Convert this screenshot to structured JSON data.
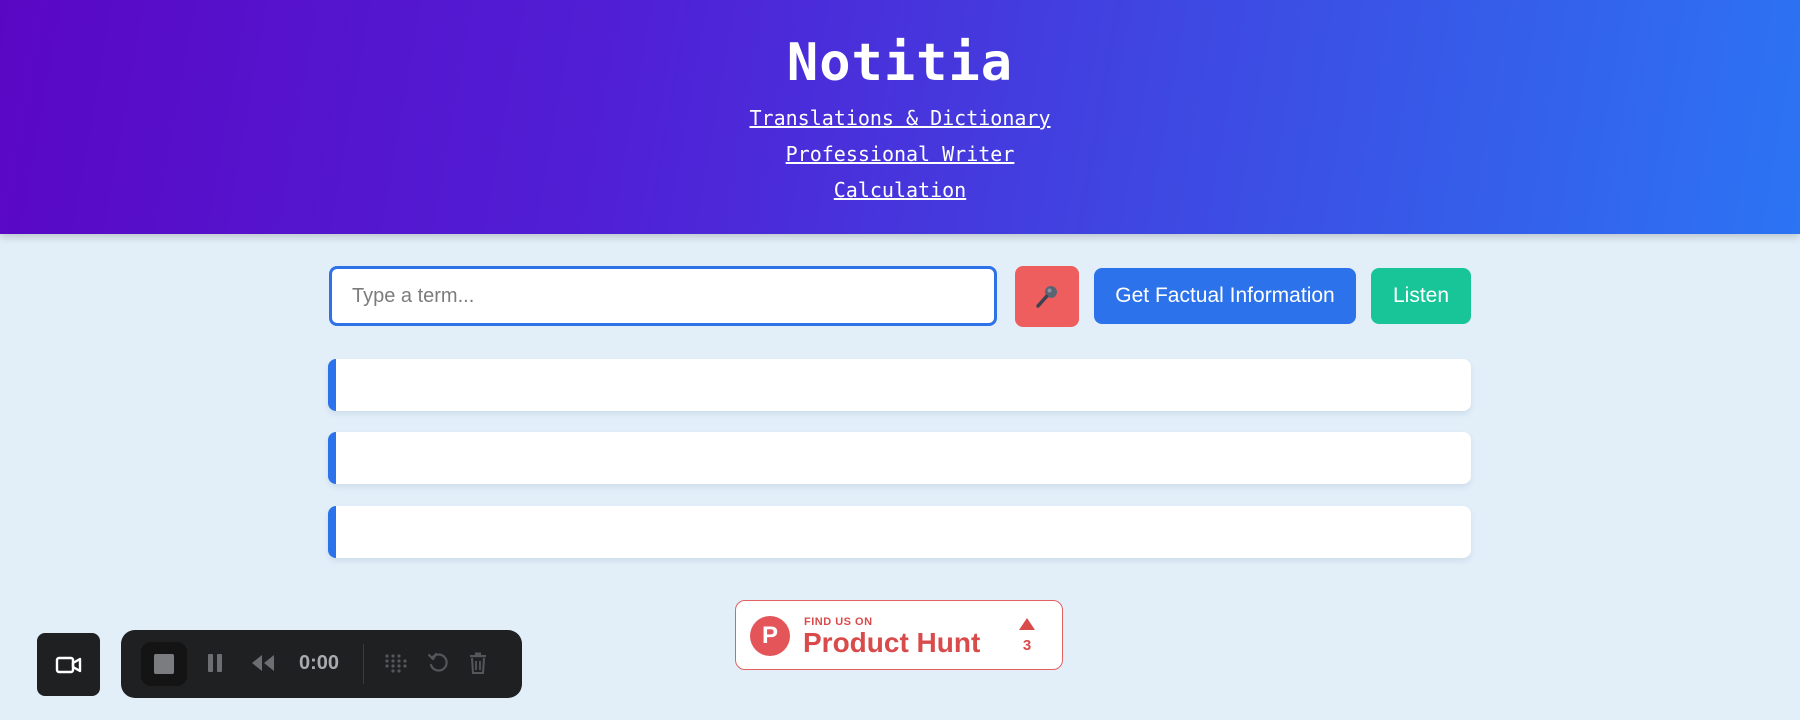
{
  "header": {
    "title": "Notitia",
    "links": [
      {
        "label": "Translations & Dictionary"
      },
      {
        "label": "Professional Writer"
      },
      {
        "label": "Calculation"
      }
    ]
  },
  "search": {
    "placeholder": "Type a term...",
    "value": ""
  },
  "buttons": {
    "mic_icon": "microphone-icon",
    "fact_label": "Get Factual Information",
    "listen_label": "Listen"
  },
  "results": [
    {
      "text": ""
    },
    {
      "text": ""
    },
    {
      "text": ""
    }
  ],
  "product_hunt": {
    "logo_letter": "P",
    "find_us_on": "FIND US ON",
    "name": "Product Hunt",
    "upvotes": "3"
  },
  "recorder": {
    "time": "0:00",
    "icons": [
      "video-camera-icon",
      "stop-icon",
      "pause-icon",
      "rewind-icon",
      "grid-icon",
      "reset-icon",
      "trash-icon"
    ]
  },
  "colors": {
    "accent": "#2c73eb",
    "mic": "#ee5e5e",
    "listen": "#18c598",
    "product_hunt": "#d94b4b"
  }
}
